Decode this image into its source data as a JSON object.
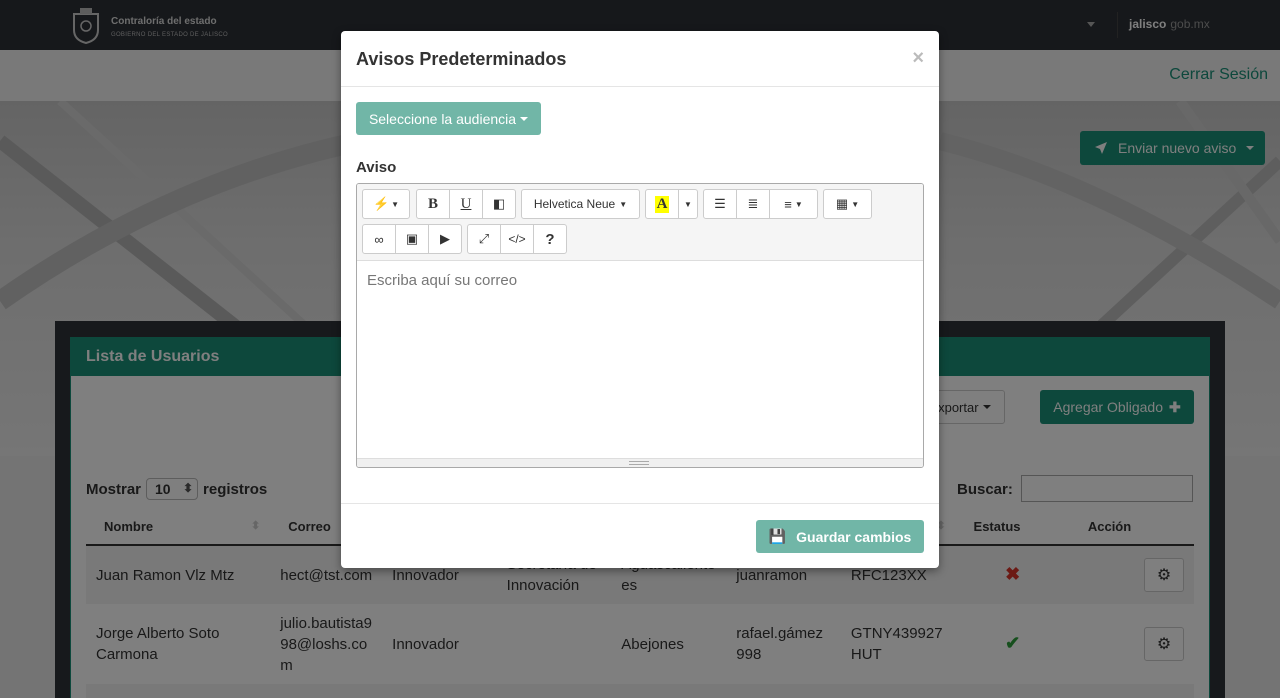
{
  "header": {
    "brand_title": "Contraloría del estado",
    "brand_subtitle": "GOBIERNO DEL ESTADO DE JALISCO",
    "site_name": "jalisco",
    "site_suffix": "gob.mx",
    "logout": "Cerrar Sesión"
  },
  "hero": {
    "send_button": "Enviar nuevo aviso"
  },
  "panel": {
    "title": "Lista de Usuarios",
    "export_button": "Exportar",
    "add_button": "Agregar Obligado",
    "show_label": "Mostrar",
    "show_value": "10",
    "records_label": "registros",
    "search_label": "Buscar:",
    "search_value": "",
    "columns": [
      "Nombre",
      "Correo",
      "",
      "",
      "",
      "",
      "",
      "Estatus",
      "Acción"
    ],
    "rows": [
      {
        "nombre": "Juan Ramon Vlz Mtz",
        "correo": "hect@tst.com",
        "c3": "Innovador",
        "c4": "Secretaría de Innovación",
        "c5": "Aguascaliente es",
        "c6": "juanramon",
        "c7": "RFC123XX",
        "estatus": "inactive"
      },
      {
        "nombre": "Jorge Alberto Soto Carmona",
        "correo": "julio.bautista998@loshs.com",
        "c3": "Innovador",
        "c4": "",
        "c5": "Abejones",
        "c6": "rafael.gámez998",
        "c7": "GTNY439927HUT",
        "estatus": "active"
      }
    ]
  },
  "modal": {
    "title": "Avisos Predeterminados",
    "close": "×",
    "audience_button": "Seleccione la audiencia",
    "field_label": "Aviso",
    "font_select": "Helvetica Neue",
    "editor_placeholder": "Escriba aquí su correo",
    "save_button": "Guardar cambios"
  },
  "colors": {
    "accent": "#1a9078",
    "accent_muted": "#71b6a7",
    "topbar": "#2c3037"
  }
}
